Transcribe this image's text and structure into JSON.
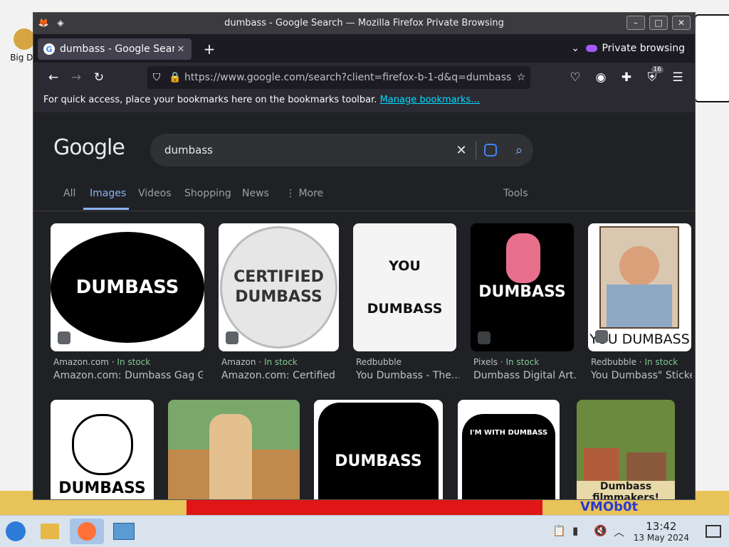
{
  "desktop": {
    "icon_label": "Big\nDe",
    "badge_text": "VMOb0t"
  },
  "window": {
    "title": "dumbass - Google Search — Mozilla Firefox Private Browsing",
    "controls": {
      "minimize": "–",
      "maximize": "□",
      "close": "✕"
    }
  },
  "tabs": [
    {
      "title": "dumbass - Google Search",
      "close": "✕"
    }
  ],
  "new_tab": "+",
  "private_label": "Private browsing",
  "url": "https://www.google.com/search?client=firefox-b-1-d&q=dumbass",
  "extension_badge": "16",
  "bookmarks_bar": {
    "message": "For quick access, place your bookmarks here on the bookmarks toolbar.",
    "link": "Manage bookmarks…"
  },
  "google": {
    "logo": "Google",
    "query": "dumbass",
    "tabs": [
      "All",
      "Images",
      "Videos",
      "Shopping",
      "News",
      "⋮ More"
    ],
    "tools": "Tools"
  },
  "results_row1": [
    {
      "source": "Amazon.com",
      "stock": "In stock",
      "title": "Amazon.com: Dumbass Gag Gift...",
      "art": "DUMBASS",
      "colors": {
        "bg": "#ffffff",
        "art": "#000000",
        "text": "#ffffff"
      }
    },
    {
      "source": "Amazon",
      "stock": "In stock",
      "title": "Amazon.com: Certified Dumbass...",
      "art": "CERTIFIED DUMBASS",
      "colors": {
        "bg": "#ffffff",
        "art": "#e6e6e6",
        "text": "#333333"
      }
    },
    {
      "source": "Redbubble",
      "stock": "",
      "title": "You Dumbass - The...",
      "art": "YOU DUMBASS",
      "colors": {
        "bg": "#ffffff",
        "art": "#ffffff",
        "text": "#111111"
      }
    },
    {
      "source": "Pixels",
      "stock": "In stock",
      "title": "Dumbass Digital Art...",
      "art": "DUMBASS",
      "colors": {
        "bg": "#000000",
        "art": "#000000",
        "text": "#ffffff"
      }
    },
    {
      "source": "Redbubble",
      "stock": "In stock",
      "title": "You Dumbass\" Sticker...",
      "art": "YOU DUMBASS",
      "colors": {
        "bg": "#ffffff",
        "art": "#8fa9c4",
        "text": "#111111"
      }
    }
  ],
  "results_row2": [
    {
      "art": "DUMBASS"
    },
    {
      "art": ""
    },
    {
      "art": "DUMBASS"
    },
    {
      "art": "I'M WITH DUMBASS"
    },
    {
      "art": "Dumbass filmmakers!"
    }
  ],
  "taskbar": {
    "time": "13:42",
    "date": "13 May 2024"
  }
}
